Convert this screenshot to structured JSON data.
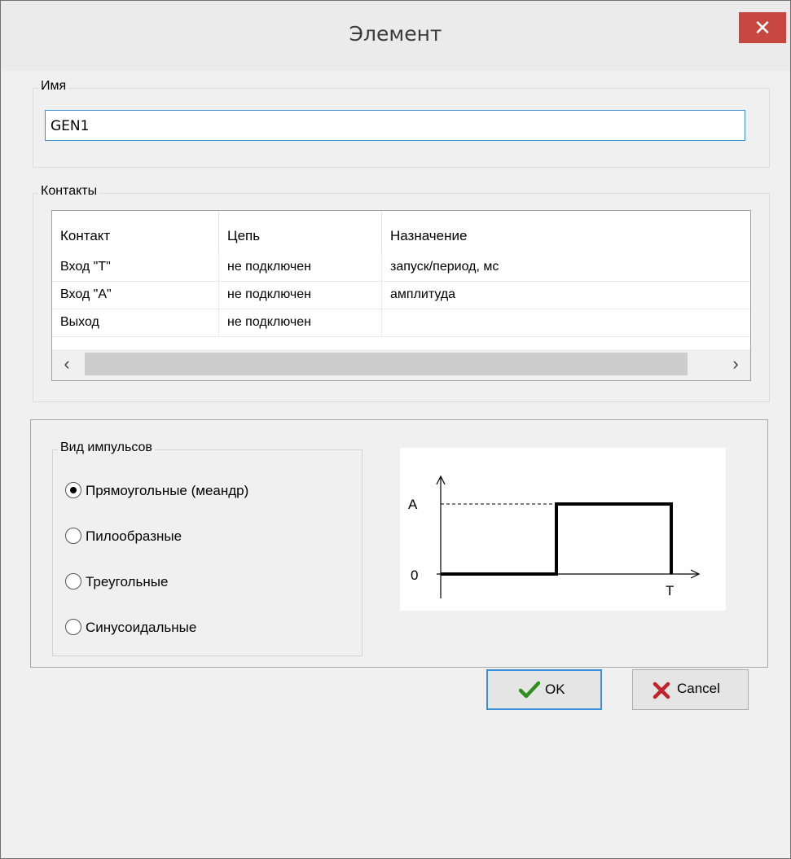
{
  "window": {
    "title": "Элемент",
    "close_glyph": "✕"
  },
  "name_group": {
    "legend": "Имя",
    "value": "GEN1"
  },
  "contacts_group": {
    "legend": "Контакты",
    "columns": [
      "Контакт",
      "Цепь",
      "Назначение"
    ],
    "rows": [
      [
        "Вход \"T\"",
        "не подключен",
        "запуск/период, мс"
      ],
      [
        "Вход \"A\"",
        "не подключен",
        "амплитуда"
      ],
      [
        "Выход",
        "не подключен",
        ""
      ]
    ],
    "scroll_left": "‹",
    "scroll_right": "›"
  },
  "pulse_group": {
    "legend": "Вид импульсов",
    "options": [
      {
        "label": "Прямоугольные (меандр)",
        "checked": true
      },
      {
        "label": "Пилообразные",
        "checked": false
      },
      {
        "label": "Треугольные",
        "checked": false
      },
      {
        "label": "Синусоидальные",
        "checked": false
      }
    ]
  },
  "diagram": {
    "label_a": "A",
    "label_zero": "0",
    "label_t": "T"
  },
  "buttons": {
    "ok_label": "OK",
    "cancel_label": "Cancel"
  },
  "colors": {
    "ok_check": "#2f8f1e",
    "cancel_x": "#c0242a",
    "close_bg": "#c7463f"
  }
}
